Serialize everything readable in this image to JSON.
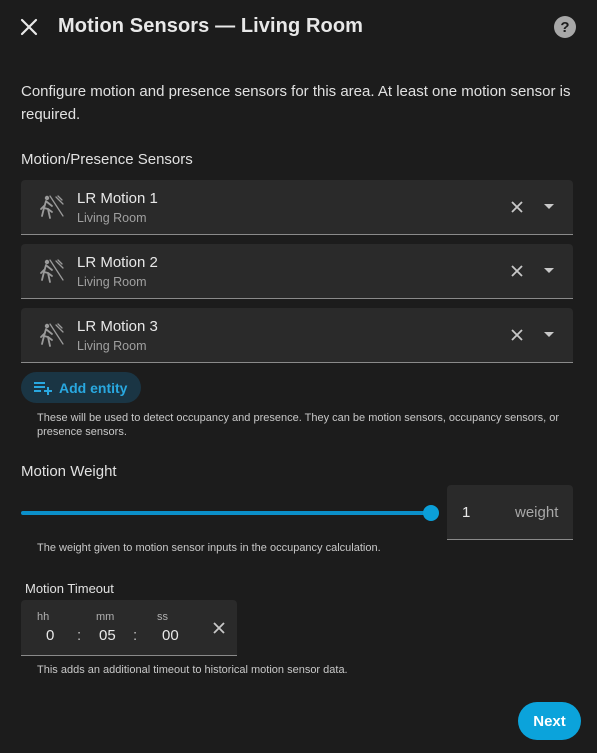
{
  "header": {
    "title": "Motion Sensors — Living Room",
    "help_text": "?"
  },
  "description": "Configure motion and presence sensors for this area. At least one motion sensor is required.",
  "sensors": {
    "label": "Motion/Presence Sensors",
    "items": [
      {
        "name": "LR Motion 1",
        "area": "Living Room",
        "icon": "motion-sensor-icon"
      },
      {
        "name": "LR Motion 2",
        "area": "Living Room",
        "icon": "motion-sensor-icon"
      },
      {
        "name": "LR Motion 3",
        "area": "Living Room",
        "icon": "motion-sensor-icon"
      }
    ],
    "add_label": "Add entity",
    "helper": "These will be used to detect occupancy and presence. They can be motion sensors, occupancy sensors, or presence sensors."
  },
  "weight": {
    "label": "Motion Weight",
    "value": "1",
    "unit": "weight",
    "slider_fraction": 1,
    "helper": "The weight given to motion sensor inputs in the occupancy calculation."
  },
  "timeout": {
    "label": "Motion Timeout",
    "hh_label": "hh",
    "mm_label": "mm",
    "ss_label": "ss",
    "hh": "0",
    "mm": "05",
    "ss": "00",
    "separator": ":",
    "helper": "This adds an additional timeout to historical motion sensor data."
  },
  "footer": {
    "next_label": "Next"
  },
  "colors": {
    "accent": "#0ba3db",
    "background": "#1c1c1c",
    "field": "#2a2a2a"
  }
}
